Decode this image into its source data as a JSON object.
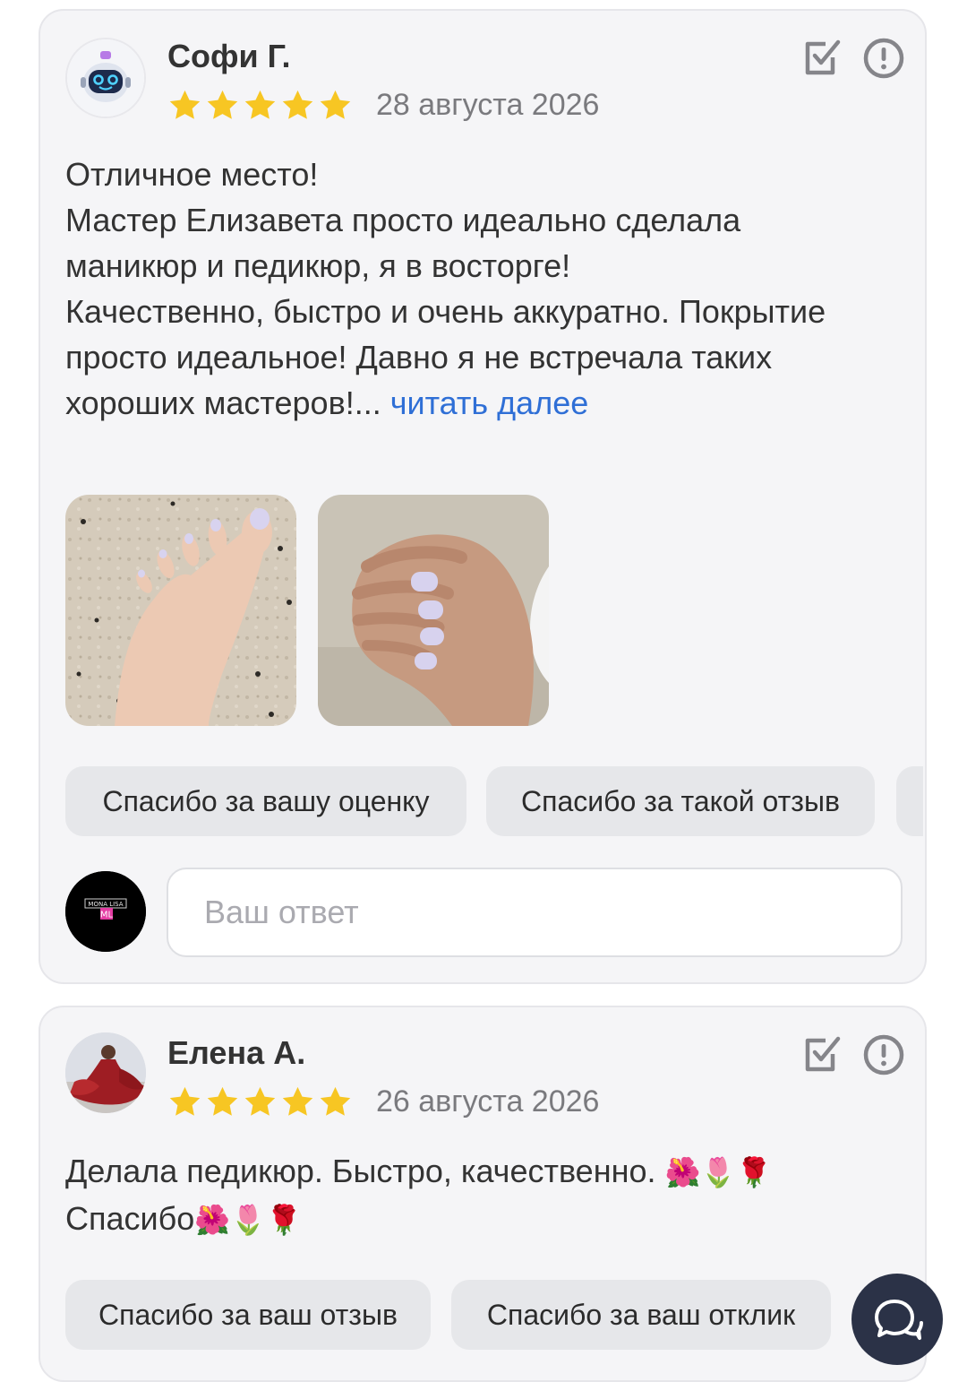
{
  "reviews": [
    {
      "author": "Софи Г.",
      "rating": 5,
      "date": "28 августа 2026",
      "text": "Отличное место!\nМастер Елизавета просто идеально сделала маникюр и педикюр, я в восторге!\nКачественно, быстро и очень аккуратно. Покрытие просто идеальное! Давно я не встречала таких хороших мастеров!...",
      "read_more": "читать далее",
      "photos": [
        "pedicure-photo",
        "manicure-photo"
      ],
      "quick_replies": [
        "Спасибо за вашу оценку",
        "Спасибо за такой отзыв"
      ],
      "reply_placeholder": "Ваш ответ",
      "business_avatar_text": "MONA LISA ML"
    },
    {
      "author": "Елена А.",
      "rating": 5,
      "date": "26 августа 2026",
      "text_line1": "Делала педикюр. Быстро, качественно.",
      "text_line2": "Спасибо",
      "emoji": "🌺🌷🌹",
      "quick_replies": [
        "Спасибо за ваш отзыв",
        "Спасибо за ваш отклик"
      ]
    }
  ],
  "icons": {
    "verify": "check-square-icon",
    "report": "exclamation-circle-icon",
    "chat": "chat-bubbles-icon"
  },
  "colors": {
    "star": "#f7c623",
    "link": "#2f6fd6",
    "card_bg": "#f5f5f7",
    "chip_bg": "#e6e7ea",
    "icon": "#85858a"
  }
}
